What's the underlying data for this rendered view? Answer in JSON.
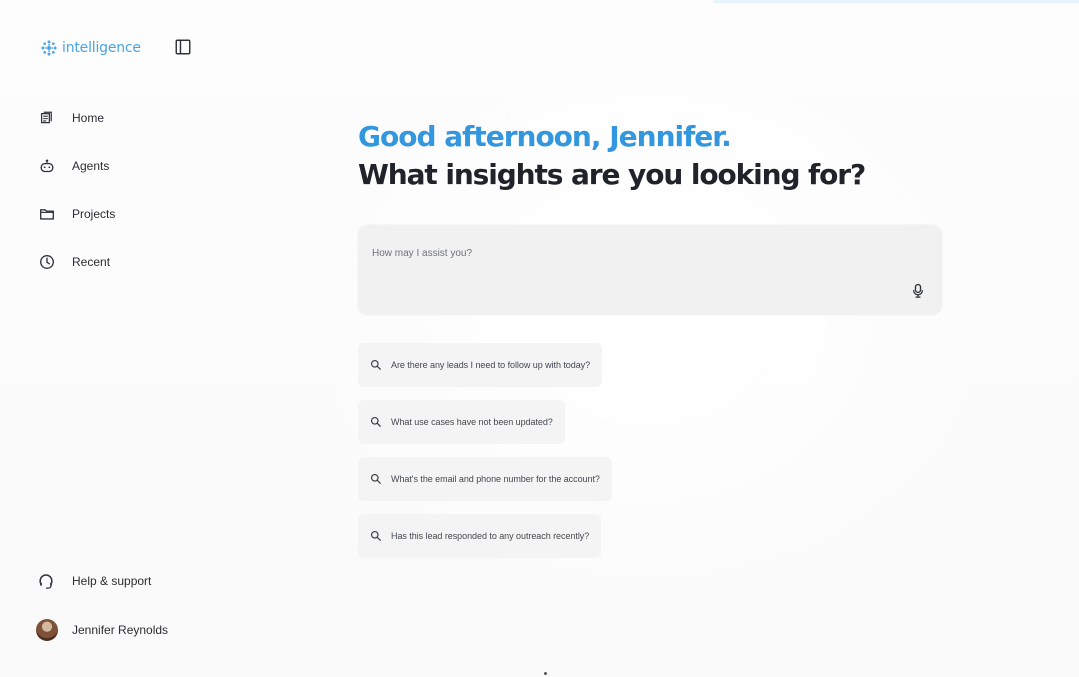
{
  "brand": {
    "name": "intelligence",
    "accent_color": "#4aa3e6"
  },
  "sidebar": {
    "toggle_icon": "panel-left-icon",
    "items": [
      {
        "label": "Home",
        "icon": "home-icon"
      },
      {
        "label": "Agents",
        "icon": "agent-icon"
      },
      {
        "label": "Projects",
        "icon": "folder-icon"
      },
      {
        "label": "Recent",
        "icon": "clock-icon"
      }
    ],
    "footer": {
      "help_label": "Help & support",
      "help_icon": "headset-icon",
      "user_name": "Jennifer Reynolds"
    }
  },
  "main": {
    "greeting": "Good afternoon, Jennifer.",
    "question": "What insights are you looking for?",
    "greeting_color": "#3397df",
    "composer": {
      "placeholder": "How may I assist you?",
      "value": "",
      "mic_icon": "microphone-icon"
    },
    "suggestions": [
      "Are there any leads I need to follow up with today?",
      "What use cases have not been updated?",
      "What's the email and phone number for the account?",
      "Has this lead responded to any outreach recently?"
    ]
  },
  "partial_edge_text": " "
}
